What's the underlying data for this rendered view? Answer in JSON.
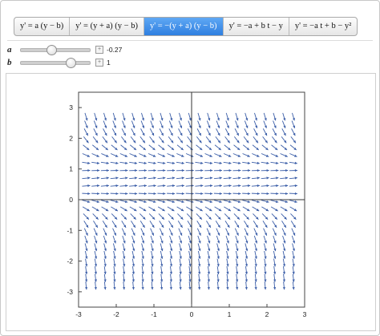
{
  "tabs": [
    {
      "label": "y' = a (y − b)",
      "selected": false
    },
    {
      "label": "y' = (y + a) (y − b)",
      "selected": false
    },
    {
      "label": "y' = −(y + a) (y − b)",
      "selected": true
    },
    {
      "label": "y' = −a + b t − y",
      "selected": false
    },
    {
      "label": "y' = −a t + b − y²",
      "selected": false
    }
  ],
  "controls": {
    "a": {
      "label": "a",
      "value": "-0.27",
      "numeric": -0.27,
      "min": -2,
      "max": 2
    },
    "b": {
      "label": "b",
      "value": "1",
      "numeric": 1,
      "min": -2,
      "max": 2
    }
  },
  "plus_icon": "+",
  "plot": {
    "xlim": [
      -3,
      3
    ],
    "ylim": [
      -3.5,
      3.5
    ],
    "xticks": [
      "-3",
      "-2",
      "-1",
      "0",
      "1",
      "2",
      "3"
    ],
    "yticks": [
      "3",
      "2",
      "1",
      "0",
      "-1",
      "-2",
      "-3"
    ],
    "field_color": "#3b5ea8",
    "grid_start": -2.8,
    "grid_step": 0.25,
    "grid_count": 23
  }
}
